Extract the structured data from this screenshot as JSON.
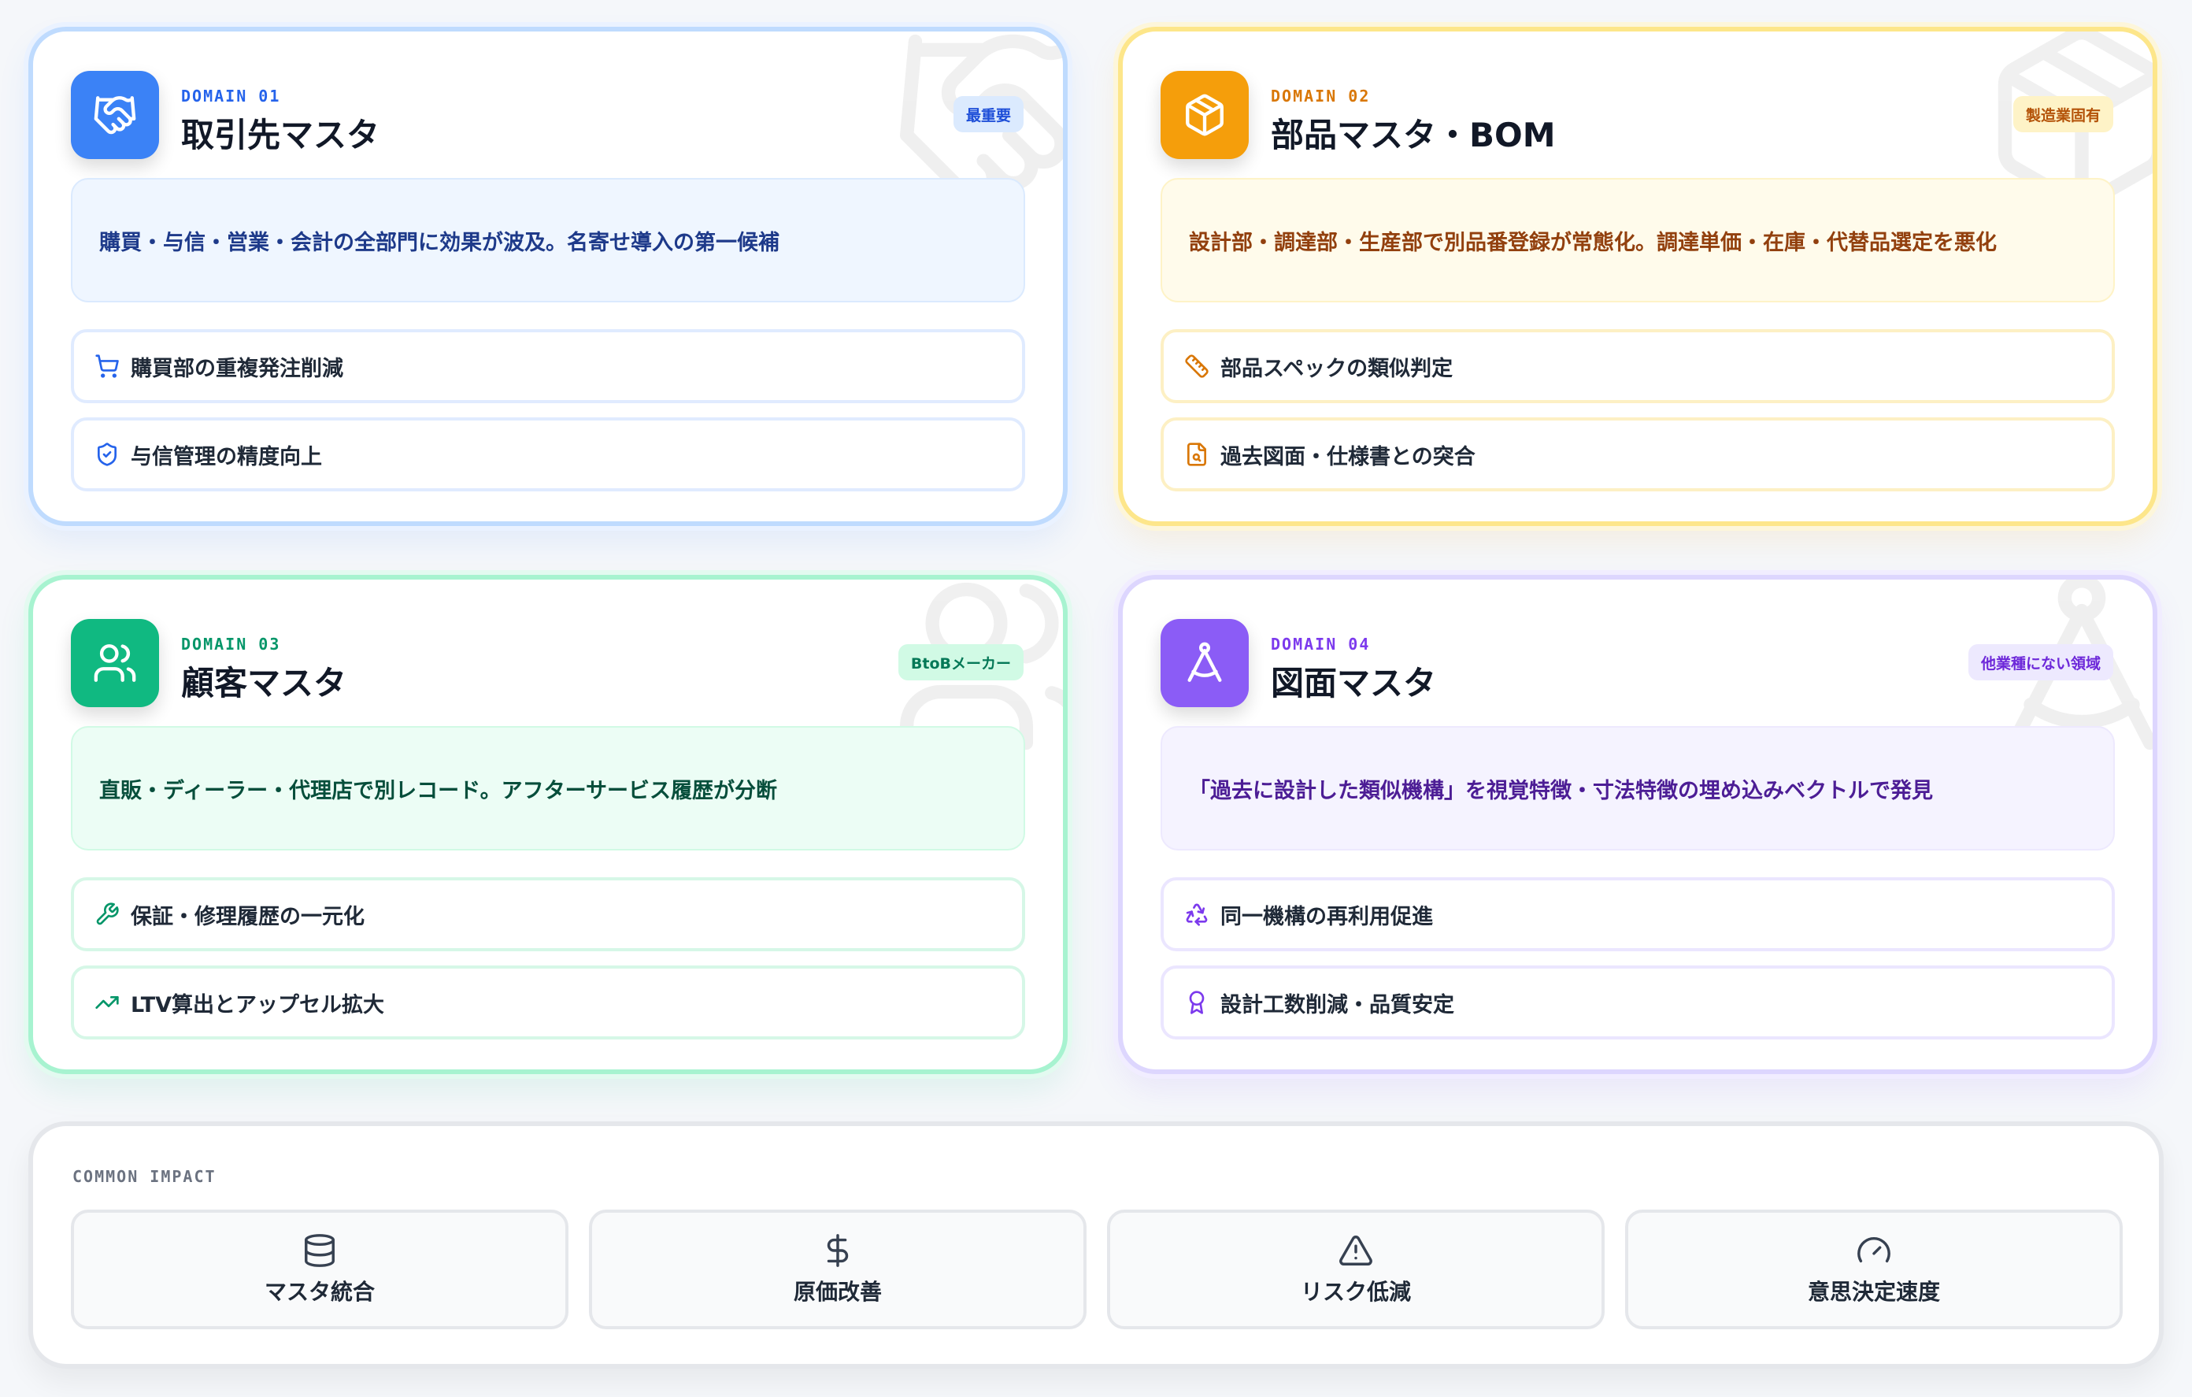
{
  "colors": {
    "blue": "#3b82f6",
    "amber": "#f59e0b",
    "green": "#10b981",
    "purple": "#8b5cf6"
  },
  "domains": [
    {
      "label": "DOMAIN 01",
      "title": "取引先マスタ",
      "badge": "最重要",
      "icon": "handshake-icon",
      "description": "購買・与信・営業・会計の全部門に効果が波及。名寄せ導入の第一候補",
      "features": [
        {
          "icon": "cart-icon",
          "label": "購買部の重複発注削減"
        },
        {
          "icon": "shield-check-icon",
          "label": "与信管理の精度向上"
        }
      ]
    },
    {
      "label": "DOMAIN 02",
      "title": "部品マスタ・BOM",
      "badge": "製造業固有",
      "icon": "package-icon",
      "description": "設計部・調達部・生産部で別品番登録が常態化。調達単価・在庫・代替品選定を悪化",
      "features": [
        {
          "icon": "ruler-icon",
          "label": "部品スペックの類似判定"
        },
        {
          "icon": "file-search-icon",
          "label": "過去図面・仕様書との突合"
        }
      ]
    },
    {
      "label": "DOMAIN 03",
      "title": "顧客マスタ",
      "badge": "BtoBメーカー",
      "icon": "users-icon",
      "description": "直販・ディーラー・代理店で別レコード。アフターサービス履歴が分断",
      "features": [
        {
          "icon": "wrench-icon",
          "label": "保証・修理履歴の一元化"
        },
        {
          "icon": "trending-up-icon",
          "label": "LTV算出とアップセル拡大"
        }
      ]
    },
    {
      "label": "DOMAIN 04",
      "title": "図面マスタ",
      "badge": "他業種にない領域",
      "icon": "compass-icon",
      "description": "「過去に設計した類似機構」を視覚特徴・寸法特徴の埋め込みベクトルで発見",
      "features": [
        {
          "icon": "recycle-icon",
          "label": "同一機構の再利用促進"
        },
        {
          "icon": "award-icon",
          "label": "設計工数削減・品質安定"
        }
      ]
    }
  ],
  "impact": {
    "label": "COMMON IMPACT",
    "items": [
      {
        "icon": "database-icon",
        "label": "マスタ統合"
      },
      {
        "icon": "dollar-icon",
        "label": "原価改善"
      },
      {
        "icon": "warning-icon",
        "label": "リスク低減"
      },
      {
        "icon": "gauge-icon",
        "label": "意思決定速度"
      }
    ]
  }
}
